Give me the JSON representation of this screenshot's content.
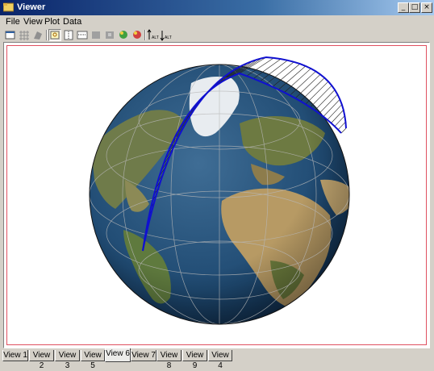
{
  "window": {
    "title": "Viewer",
    "buttons": {
      "minimize": "_",
      "maximize": "□",
      "close": "×"
    }
  },
  "menu": [
    "File",
    "View",
    "Plot",
    "Data"
  ],
  "toolbar": {
    "icons": [
      "window-icon",
      "grid-icon",
      "globe-icon",
      "zoom-icon",
      "vertical-lines-icon",
      "horizontal-lines-icon",
      "nav-icon",
      "nav2-icon",
      "globe-green-icon",
      "globe-red-icon",
      "alt-up-icon",
      "alt-down-icon"
    ],
    "alt_up_label": "ALT",
    "alt_down_label": "ALT"
  },
  "colors": {
    "track": "#1010d0",
    "ocean": "#1b3f6b",
    "land": "#9c8a5a",
    "plot_border": "#e05060"
  },
  "tabs": [
    "View 1",
    "View 2",
    "View 3",
    "View 5",
    "View 6",
    "View 7",
    "View 8",
    "View 9",
    "View 4"
  ],
  "active_tab": "View 6"
}
